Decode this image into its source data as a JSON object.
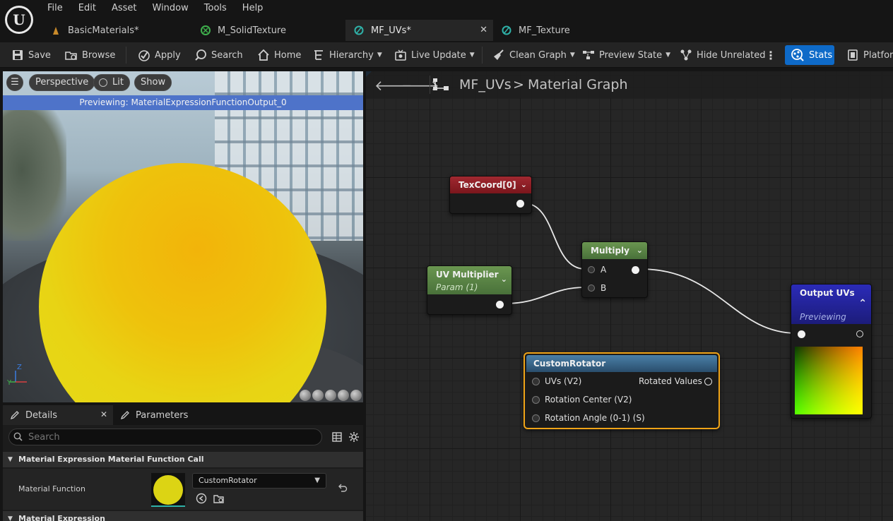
{
  "menu": [
    "File",
    "Edit",
    "Asset",
    "Window",
    "Tools",
    "Help"
  ],
  "tabs": [
    {
      "label": "BasicMaterials*",
      "icon": "material-icon"
    },
    {
      "label": "M_SolidTexture",
      "icon": "material-instance-icon"
    },
    {
      "label": "MF_UVs*",
      "icon": "material-function-icon",
      "active": true
    },
    {
      "label": "MF_Texture",
      "icon": "material-function-icon"
    }
  ],
  "toolbar": {
    "save": "Save",
    "browse": "Browse",
    "apply": "Apply",
    "search": "Search",
    "home": "Home",
    "hierarchy": "Hierarchy",
    "live_update": "Live Update",
    "clean_graph": "Clean Graph",
    "preview_state": "Preview State",
    "hide_unrelated": "Hide Unrelated",
    "stats": "Stats",
    "platforms": "Platforms"
  },
  "viewport": {
    "perspective": "Perspective",
    "lit": "Lit",
    "show": "Show",
    "previewing": "Previewing: MaterialExpressionFunctionOutput_0",
    "axis": {
      "z": "Z",
      "y": "Y"
    }
  },
  "details": {
    "tab_details": "Details",
    "tab_parameters": "Parameters",
    "search_placeholder": "Search",
    "category1": "Material Expression Material Function Call",
    "material_function_label": "Material Function",
    "material_function_value": "CustomRotator",
    "category2": "Material Expression"
  },
  "graph": {
    "breadcrumb_root": "MF_UVs",
    "breadcrumb_sep": ">",
    "breadcrumb_leaf": "Material Graph",
    "nodes": {
      "texcoord": {
        "title": "TexCoord[0]"
      },
      "uv_multiplier": {
        "title": "UV Multiplier",
        "subtitle": "Param (1)"
      },
      "multiply": {
        "title": "Multiply",
        "pin_a": "A",
        "pin_b": "B"
      },
      "output_uvs": {
        "title": "Output UVs",
        "subtitle": "Previewing"
      },
      "custom_rotator": {
        "title": "CustomRotator",
        "inputs": [
          "UVs (V2)",
          "Rotation Center (V2)",
          "Rotation Angle (0-1) (S)"
        ],
        "output": "Rotated Values"
      }
    }
  },
  "colors": {
    "accent": "#0e6ac8",
    "texcoord_header": "#8e1c22",
    "multiply_header": "#5e8a46",
    "param_header": "#5e8a46",
    "output_header": "#2a2aa8",
    "function_header": "#3a6f9a",
    "selection": "#f0a417",
    "sphere": "#e8d414"
  }
}
